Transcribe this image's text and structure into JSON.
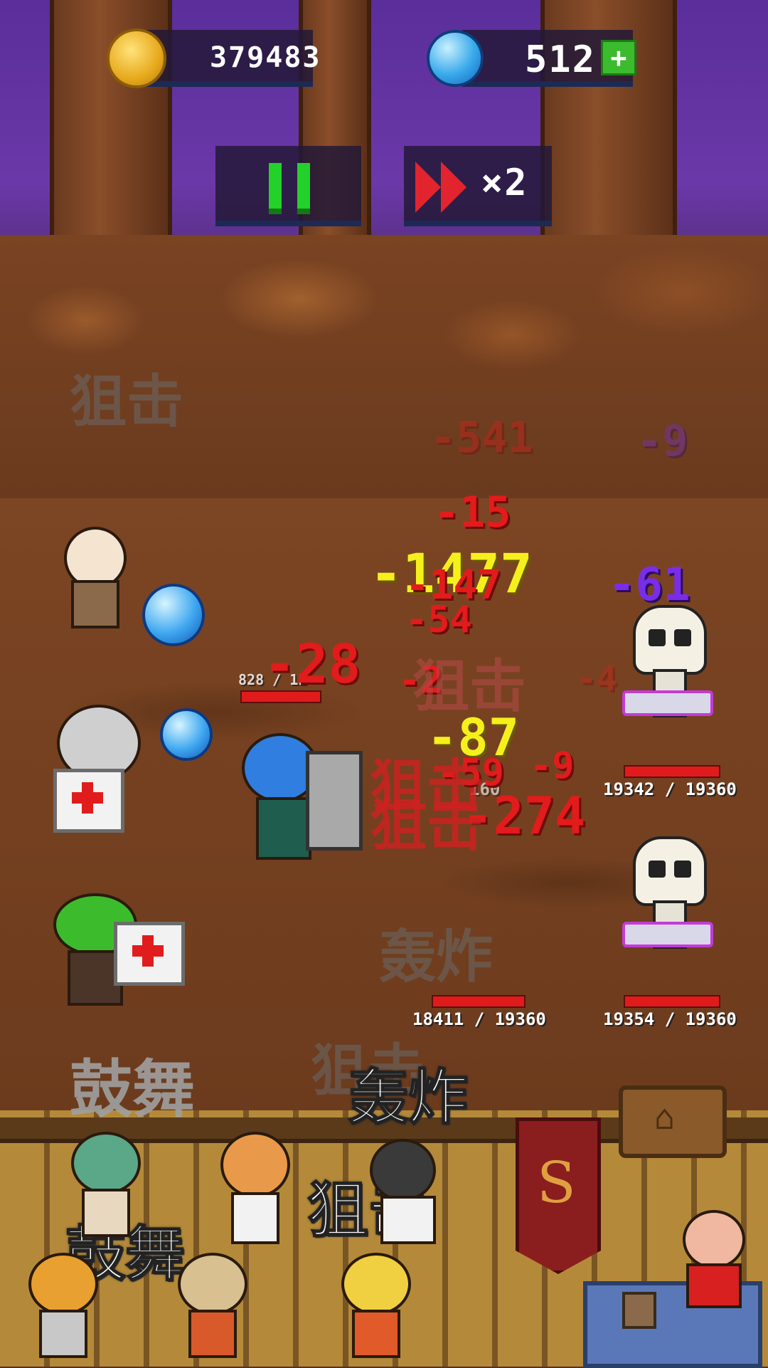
{
  "hud": {
    "coins": "379483",
    "gems": "512",
    "add_gems": "+",
    "speed_label": "×2",
    "icons": {
      "coin": "gold-coin-icon",
      "gem": "blue-gem-icon",
      "pause": "pause-icon",
      "fast_forward": "fast-forward-icon"
    }
  },
  "skills": {
    "snipe": "狙击",
    "drum_dance": "鼓舞",
    "bombard": "轰炸"
  },
  "damage_numbers": {
    "d1": "-541",
    "d2": "-15",
    "d3": "-1477",
    "d4": "-147",
    "d5": "-54",
    "d6": "-61",
    "d7": "-9",
    "d8": "-28",
    "d9": "-4",
    "d10": "-87",
    "d11": "-59",
    "d12": "-9",
    "d13": "-274",
    "d14": "-2"
  },
  "heroes": {
    "tank_hp_text": "828 / 11"
  },
  "enemies": [
    {
      "name": "skeleton",
      "hp": "19342 / 19360"
    },
    {
      "name": "skeleton",
      "hp": "19354 / 19360"
    },
    {
      "name": "enemy",
      "hp": "18411 / 19360"
    },
    {
      "name": "enemy",
      "hp": "160"
    }
  ],
  "colors": {
    "damage": "#e21b1b",
    "crit": "#f5f01c",
    "magic": "#7a2de8",
    "hp_bar": "#e01b1b"
  }
}
